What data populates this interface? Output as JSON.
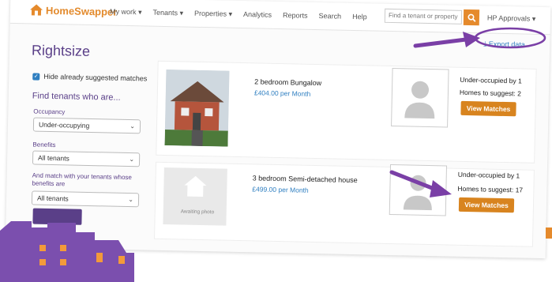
{
  "nav": {
    "logo": {
      "home": "Home",
      "swapper": "Swapper"
    },
    "menu": [
      "My work ▾",
      "Tenants ▾",
      "Properties ▾",
      "Analytics",
      "Reports",
      "Search",
      "Help"
    ],
    "search_placeholder": "Find a tenant or property",
    "user": "HP Approvals ▾"
  },
  "page": {
    "title": "Rightsize",
    "export_label": "Export data"
  },
  "sidebar": {
    "hide_label": "Hide already suggested matches",
    "find_heading": "Find tenants who are...",
    "occupancy_label": "Occupancy",
    "occupancy_value": "Under-occupying",
    "benefits_label": "Benefits",
    "benefits_value": "All tenants",
    "match_label_1": "And match with your tenants whose",
    "match_label_2": "benefits are",
    "match_value": "All tenants"
  },
  "listings": [
    {
      "property_type": "2 bedroom Bungalow",
      "price": "£404.00 per Month",
      "tenant_status": "Under-occupied by 1",
      "homes_to_suggest": "Homes to suggest: 2",
      "button": "View Matches"
    },
    {
      "property_type": "3 bedroom Semi-detached house",
      "price": "£499.00 per Month",
      "photo_text": "Awaiting photo",
      "tenant_status": "Under-occupied by 1",
      "homes_to_suggest": "Homes to suggest: 17",
      "button": "View Matches"
    }
  ],
  "colors": {
    "accent": "#e58a2c",
    "brand": "#5a3f88",
    "link": "#2f7fc1",
    "annotation": "#7a3fa6"
  }
}
